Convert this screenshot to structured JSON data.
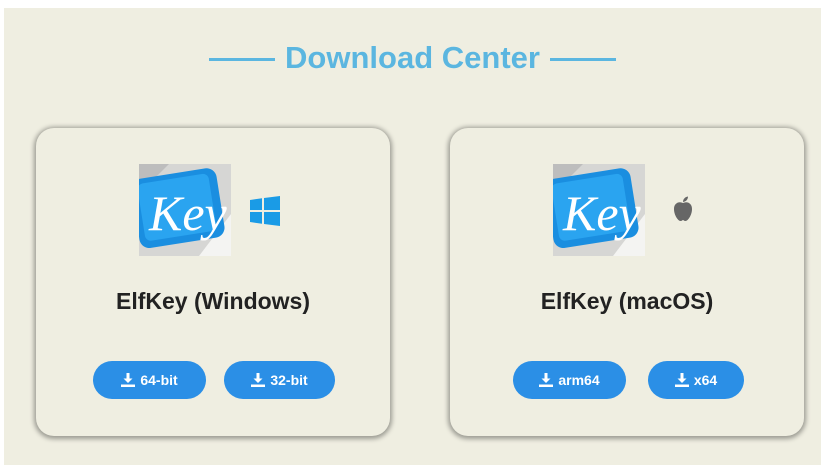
{
  "header": {
    "title": "Download Center"
  },
  "products": [
    {
      "name": "ElfKey (Windows)",
      "logo_text": "Key",
      "os_icon": "windows-icon",
      "buttons": [
        {
          "label": "64-bit",
          "icon": "download-icon"
        },
        {
          "label": "32-bit",
          "icon": "download-icon"
        }
      ]
    },
    {
      "name": "ElfKey (macOS)",
      "logo_text": "Key",
      "os_icon": "apple-icon",
      "buttons": [
        {
          "label": "arm64",
          "icon": "download-icon"
        },
        {
          "label": "x64",
          "icon": "download-icon"
        }
      ]
    }
  ],
  "colors": {
    "page_background": "#efeee1",
    "title_color": "#5bb6e0",
    "button_color": "#2b8fe6",
    "windows_icon_color": "#1a9be6",
    "apple_icon_color": "#666666"
  }
}
